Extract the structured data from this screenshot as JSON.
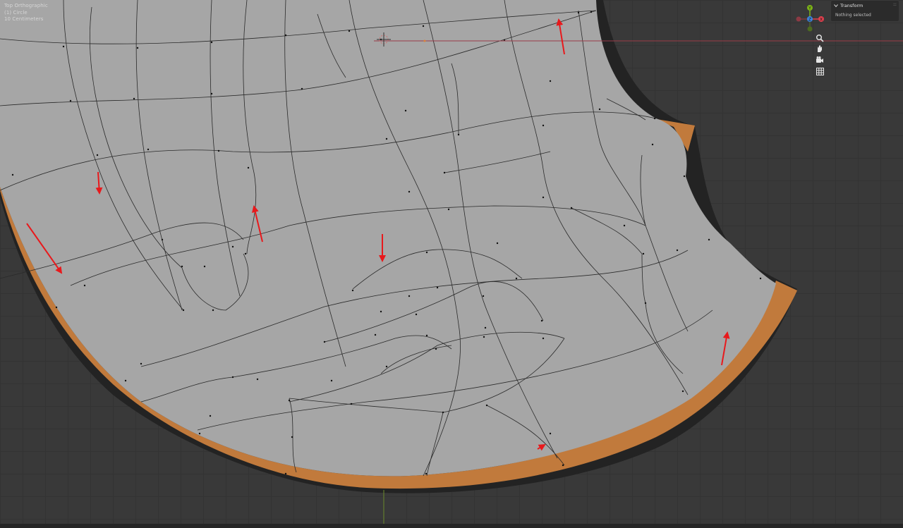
{
  "viewport": {
    "view_name": "Top Orthographic",
    "object_info": "(1) Circle",
    "scale_info": "10 Centimeters"
  },
  "gizmo": {
    "axes": [
      "Y",
      "X",
      "Z"
    ],
    "colors": {
      "x": "#e2404e",
      "y": "#7cb318",
      "z": "#3c86e0"
    }
  },
  "nav_buttons": [
    "zoom-icon",
    "hand-pan-icon",
    "camera-icon",
    "grid-icon"
  ],
  "transform_panel": {
    "title": "Transform",
    "status": "Nothing selected"
  },
  "colors": {
    "background": "#393939",
    "mesh_face": "#a6a6a6",
    "mesh_edge": "#2a2a2a",
    "rim": "#c17a3c",
    "annotation": "#e8191c",
    "x_axis_line": "#9a3b48",
    "y_axis_line": "#6d8c2c"
  }
}
